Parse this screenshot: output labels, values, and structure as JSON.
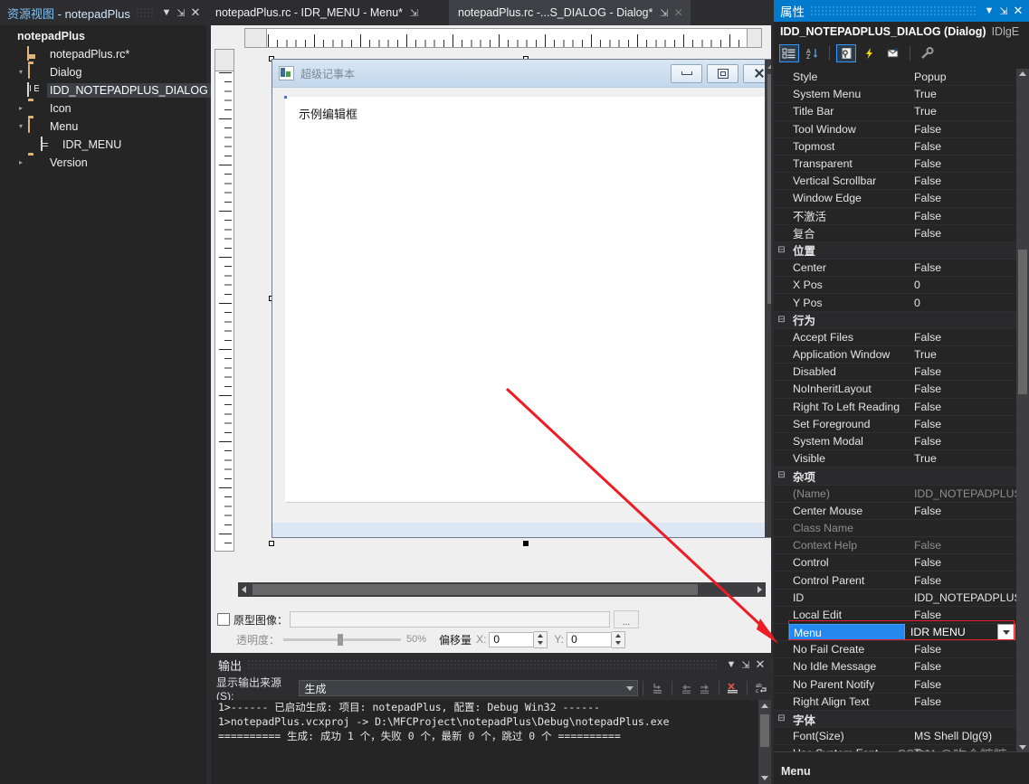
{
  "resource_view": {
    "title_prefix": "资源视图",
    "title_sep": " - ",
    "title_project": "notepadPlus",
    "buttons": {
      "dropdown": "▼",
      "pin": "⇲",
      "close": "✕"
    },
    "tree": [
      {
        "label": "notepadPlus",
        "icon": "project-icon",
        "depth": 0,
        "twist": "",
        "bold": true,
        "selected": false
      },
      {
        "label": "notepadPlus.rc*",
        "icon": "rc-file-icon",
        "depth": 1,
        "twist": "",
        "bold": false,
        "selected": false
      },
      {
        "label": "Dialog",
        "icon": "folder-open-icon",
        "depth": 1,
        "twist": "▾",
        "bold": false,
        "selected": false
      },
      {
        "label": "IDD_NOTEPADPLUS_DIALOG",
        "icon": "dialog-resource-icon",
        "depth": 2,
        "twist": "",
        "bold": false,
        "selected": true
      },
      {
        "label": "Icon",
        "icon": "folder-icon",
        "depth": 1,
        "twist": "▸",
        "bold": false,
        "selected": false
      },
      {
        "label": "Menu",
        "icon": "folder-open-icon",
        "depth": 1,
        "twist": "▾",
        "bold": false,
        "selected": false
      },
      {
        "label": "IDR_MENU",
        "icon": "menu-resource-icon",
        "depth": 2,
        "twist": "",
        "bold": false,
        "selected": false
      },
      {
        "label": "Version",
        "icon": "folder-icon",
        "depth": 1,
        "twist": "▸",
        "bold": false,
        "selected": false
      }
    ]
  },
  "tabs": {
    "items": [
      {
        "label": "notepadPlus.rc - IDR_MENU - Menu*",
        "active": false,
        "pin": "⇲",
        "close": ""
      },
      {
        "label": "notepadPlus.rc -...S_DIALOG - Dialog*",
        "active": true,
        "pin": "⇲",
        "close": "✕"
      }
    ],
    "overflow_glyph": "▼"
  },
  "designer": {
    "dialog": {
      "title": "超级记事本",
      "edit_text": "示例编辑框",
      "buttons": {
        "minimize": "minimize-icon",
        "maximize": "maximize-icon",
        "close": "close-icon"
      }
    }
  },
  "proto_bar": {
    "checkbox_label": "原型图像：",
    "path_value": "",
    "browse_label": "...",
    "transparency_label": "透明度：",
    "transparency_percent": "50%",
    "offset_label": "偏移量",
    "x_label": "X:",
    "x_value": "0",
    "y_label": "Y:",
    "y_value": "0"
  },
  "output_panel": {
    "title": "输出",
    "buttons": {
      "dropdown": "▼",
      "pin": "⇲",
      "close": "✕"
    },
    "source_label": "显示输出来源(S):",
    "source_value": "生成",
    "toolbar_icons": [
      "jump-to-message-icon",
      "previous-message-icon",
      "next-message-icon",
      "clear-all-icon",
      "toggle-word-wrap-icon"
    ],
    "lines": [
      "1>------ 已启动生成: 项目: notepadPlus, 配置: Debug Win32 ------",
      "1>notepadPlus.vcxproj -> D:\\MFCProject\\notepadPlus\\Debug\\notepadPlus.exe",
      "========== 生成: 成功 1 个，失败 0 个，最新 0 个，跳过 0 个 =========="
    ]
  },
  "properties": {
    "panel_title": "属性",
    "header_buttons": {
      "dropdown": "▼",
      "pin": "⇲",
      "close": "✕"
    },
    "object_name": "IDD_NOTEPADPLUS_DIALOG (Dialog)",
    "object_type": "IDlgE",
    "toolbar_icons": [
      "categorized-icon",
      "alphabetical-icon",
      "properties-icon",
      "events-icon",
      "messages-icon",
      "property-pages-icon"
    ],
    "selected_row": "Menu",
    "description_name": "Menu",
    "rows": [
      {
        "kind": "prop",
        "name": "Style",
        "value": "Popup"
      },
      {
        "kind": "prop",
        "name": "System Menu",
        "value": "True"
      },
      {
        "kind": "prop",
        "name": "Title Bar",
        "value": "True"
      },
      {
        "kind": "prop",
        "name": "Tool Window",
        "value": "False"
      },
      {
        "kind": "prop",
        "name": "Topmost",
        "value": "False"
      },
      {
        "kind": "prop",
        "name": "Transparent",
        "value": "False"
      },
      {
        "kind": "prop",
        "name": "Vertical Scrollbar",
        "value": "False"
      },
      {
        "kind": "prop",
        "name": "Window Edge",
        "value": "False"
      },
      {
        "kind": "prop",
        "name": "不激活",
        "value": "False"
      },
      {
        "kind": "prop",
        "name": "复合",
        "value": "False"
      },
      {
        "kind": "cat",
        "name": "位置",
        "value": ""
      },
      {
        "kind": "prop",
        "name": "Center",
        "value": "False"
      },
      {
        "kind": "prop",
        "name": "X Pos",
        "value": "0"
      },
      {
        "kind": "prop",
        "name": "Y Pos",
        "value": "0"
      },
      {
        "kind": "cat",
        "name": "行为",
        "value": ""
      },
      {
        "kind": "prop",
        "name": "Accept Files",
        "value": "False"
      },
      {
        "kind": "prop",
        "name": "Application Window",
        "value": "True"
      },
      {
        "kind": "prop",
        "name": "Disabled",
        "value": "False"
      },
      {
        "kind": "prop",
        "name": "NoInheritLayout",
        "value": "False"
      },
      {
        "kind": "prop",
        "name": "Right To Left Reading",
        "value": "False"
      },
      {
        "kind": "prop",
        "name": "Set Foreground",
        "value": "False"
      },
      {
        "kind": "prop",
        "name": "System Modal",
        "value": "False"
      },
      {
        "kind": "prop",
        "name": "Visible",
        "value": "True"
      },
      {
        "kind": "cat",
        "name": "杂项",
        "value": ""
      },
      {
        "kind": "prop",
        "name": "(Name)",
        "value": "IDD_NOTEPADPLUS_I",
        "dim": true
      },
      {
        "kind": "prop",
        "name": "Center Mouse",
        "value": "False"
      },
      {
        "kind": "prop",
        "name": "Class Name",
        "value": "",
        "dim": true
      },
      {
        "kind": "prop",
        "name": "Context Help",
        "value": "False",
        "dim": true
      },
      {
        "kind": "prop",
        "name": "Control",
        "value": "False"
      },
      {
        "kind": "prop",
        "name": "Control Parent",
        "value": "False"
      },
      {
        "kind": "prop",
        "name": "ID",
        "value": "IDD_NOTEPADPLUS_I"
      },
      {
        "kind": "prop",
        "name": "Local Edit",
        "value": "False"
      },
      {
        "kind": "prop",
        "name": "Menu",
        "value": "IDR MENU",
        "selected": true
      },
      {
        "kind": "prop",
        "name": "No Fail Create",
        "value": "False"
      },
      {
        "kind": "prop",
        "name": "No Idle Message",
        "value": "False"
      },
      {
        "kind": "prop",
        "name": "No Parent Notify",
        "value": "False"
      },
      {
        "kind": "prop",
        "name": "Right Align Text",
        "value": "False"
      },
      {
        "kind": "cat",
        "name": "字体",
        "value": ""
      },
      {
        "kind": "prop",
        "name": "Font(Size)",
        "value": "MS Shell Dlg(9)"
      },
      {
        "kind": "prop",
        "name": "Use System Font",
        "value": "True"
      }
    ]
  },
  "watermark": "CSDN @吃个糖糖",
  "colors": {
    "accent": "#007acc",
    "selection_blue": "#2488ef",
    "annotation_red": "#ee1c24",
    "panel_bg": "#252526",
    "chrome_bg": "#2d2d30",
    "folder_gold": "#dcb67a"
  }
}
